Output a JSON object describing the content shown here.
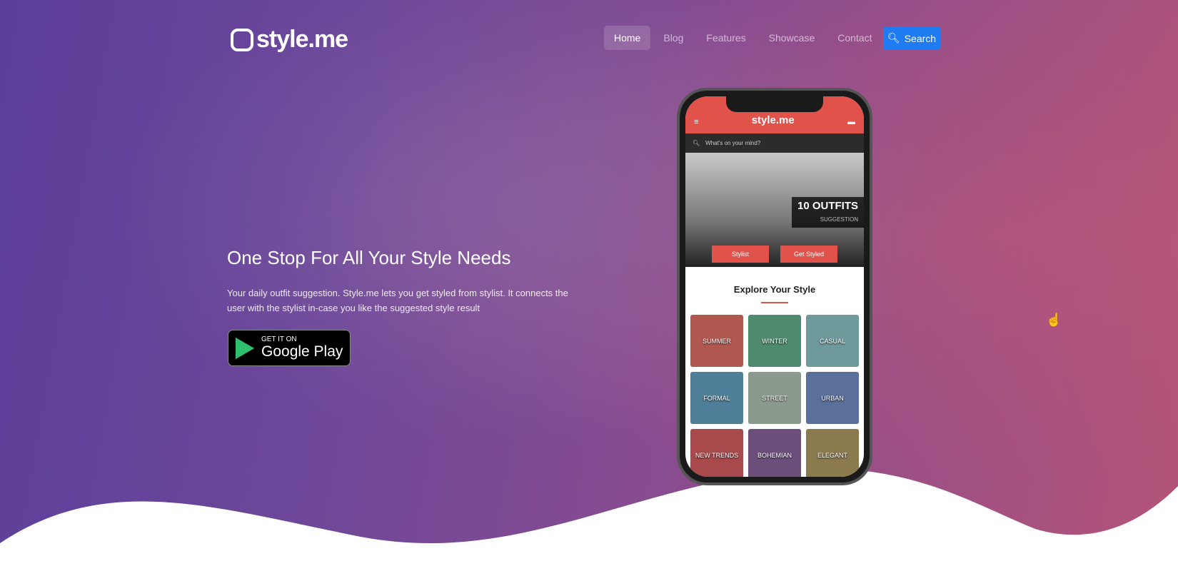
{
  "brand": "style.me",
  "nav": {
    "items": [
      "Home",
      "Blog",
      "Features",
      "Showcase",
      "Contact"
    ],
    "active": "Home",
    "search_label": "Search"
  },
  "hero": {
    "title": "One Stop For All Your Style Needs",
    "description": "Your daily outfit suggestion. Style.me lets you get styled from stylist. It connects the user with the stylist in-case you like the suggested style result",
    "badge_small": "GET IT ON",
    "badge_big": "Google Play"
  },
  "phone": {
    "brand": "style.me",
    "search_placeholder": "What's on your mind?",
    "banner_title": "10 OUTFITS",
    "banner_sub": "SUGGESTION",
    "btn_stylist": "Stylist",
    "btn_get_styled": "Get Styled",
    "section_title": "Explore Your Style",
    "categories": [
      {
        "label": "SUMMER",
        "color": "#b0584f"
      },
      {
        "label": "WINTER",
        "color": "#4f8a6e"
      },
      {
        "label": "CASUAL",
        "color": "#6f9a9c"
      },
      {
        "label": "FORMAL",
        "color": "#4f7f98"
      },
      {
        "label": "STREET",
        "color": "#8c9a8e"
      },
      {
        "label": "URBAN",
        "color": "#5a6f99"
      },
      {
        "label": "NEW TRENDS",
        "color": "#a8494c"
      },
      {
        "label": "BOHEMIAN",
        "color": "#6b4f7a"
      },
      {
        "label": "ELEGANT",
        "color": "#8a7a4e"
      }
    ]
  },
  "colors": {
    "accent": "#1e7bf2",
    "phone_red": "#e0524a"
  }
}
